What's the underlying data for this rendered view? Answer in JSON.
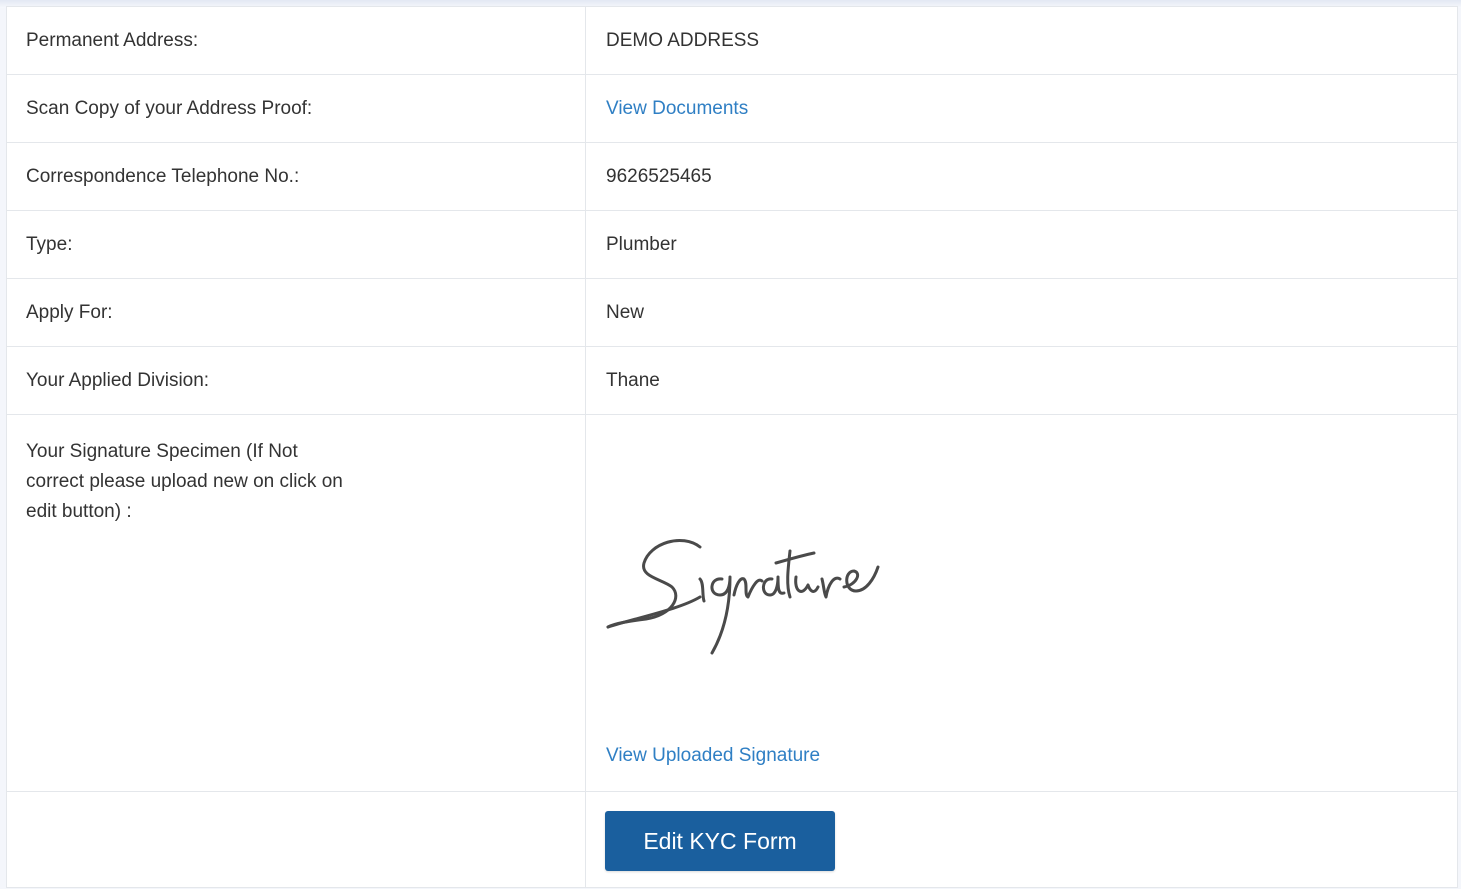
{
  "rows": [
    {
      "label": "Permanent Address:",
      "value": "DEMO ADDRESS"
    },
    {
      "label": "Scan Copy of your Address Proof:",
      "value": "View Documents"
    },
    {
      "label": "Correspondence Telephone No.:",
      "value": "9626525465"
    },
    {
      "label": "Type:",
      "value": "Plumber"
    },
    {
      "label": "Apply For:",
      "value": "New"
    },
    {
      "label": "Your Applied Division:",
      "value": "Thane"
    }
  ],
  "signature": {
    "label": "Your Signature Specimen (If Not correct please upload new on click on edit button) :",
    "image_text": "Signature",
    "view_link": "View Uploaded Signature"
  },
  "actions": {
    "edit_label": "Edit KYC Form"
  },
  "colors": {
    "link": "#2f7fc4",
    "button": "#1a5f9e"
  }
}
